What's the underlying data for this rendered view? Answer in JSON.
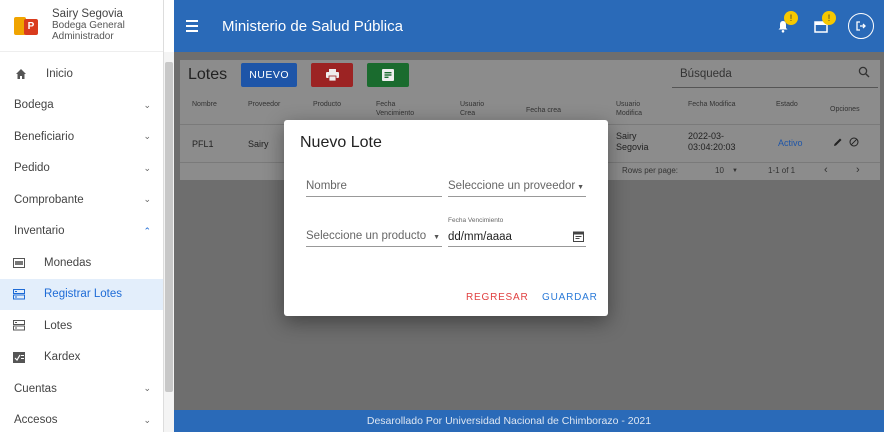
{
  "user": {
    "name": "Sairy Segovia",
    "line1": "Bodega General",
    "line2": "Administrador"
  },
  "sidebar": {
    "items": [
      {
        "label": "Inicio"
      },
      {
        "label": "Bodega"
      },
      {
        "label": "Beneficiario"
      },
      {
        "label": "Pedido"
      },
      {
        "label": "Comprobante"
      },
      {
        "label": "Inventario"
      },
      {
        "label": "Monedas"
      },
      {
        "label": "Registrar Lotes"
      },
      {
        "label": "Lotes"
      },
      {
        "label": "Kardex"
      },
      {
        "label": "Cuentas"
      },
      {
        "label": "Accesos"
      }
    ]
  },
  "topbar": {
    "title": "Ministerio de Salud Pública",
    "notif_count": "!",
    "calendar_count": "!"
  },
  "toolbar": {
    "title": "Lotes",
    "nuevo_label": "NUEVO"
  },
  "search": {
    "placeholder": "Búsqueda"
  },
  "table": {
    "headers": {
      "nombre": "Nombre",
      "proveedor": "Proveedor",
      "producto": "Producto",
      "fecha_venc": "Fecha Vencimiento",
      "usuario_crea": "Usuario Crea",
      "fecha_crea": "Fecha crea",
      "usuario_mod": "Usuario Modifica",
      "fecha_mod": "Fecha Modifica",
      "estado": "Estado",
      "opciones": "Opciones"
    },
    "row": {
      "nombre": "PFL1",
      "proveedor": "Sairy",
      "usuario_mod": "Sairy Segovia",
      "fecha_mod": "2022-03-03:04:20:03",
      "estado": "Activo"
    },
    "footer": {
      "rows_per_page_label": "Rows per page:",
      "rows_per_page": "10",
      "range": "1-1 of 1"
    }
  },
  "dialog": {
    "title": "Nuevo Lote",
    "nombre_placeholder": "Nombre",
    "proveedor_placeholder": "Seleccione un proveedor",
    "producto_placeholder": "Seleccione un producto",
    "fecha_label": "Fecha Vencimiento",
    "fecha_value": "dd/mm/aaaa",
    "regresar": "REGRESAR",
    "guardar": "GUARDAR"
  },
  "footer": {
    "text": "Desarollado Por Universidad Nacional de Chimborazo - 2021"
  },
  "colors": {
    "primary": "#2a6ab8",
    "accent_red": "#e04040",
    "accent_blue": "#2a7ad8",
    "badge": "#f7c800"
  }
}
